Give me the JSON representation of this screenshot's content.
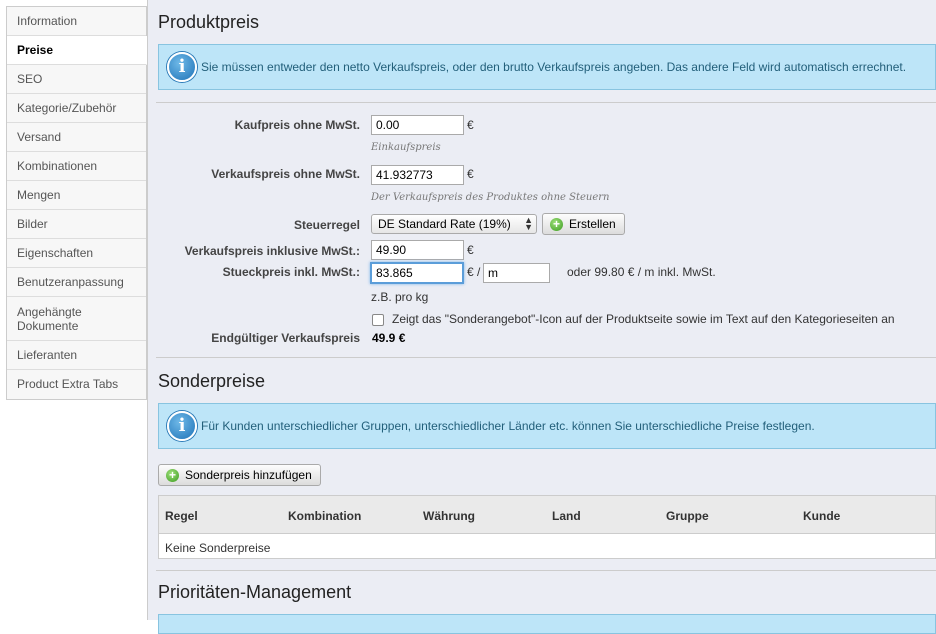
{
  "sidebar": {
    "items": [
      {
        "label": "Information"
      },
      {
        "label": "Preise"
      },
      {
        "label": "SEO"
      },
      {
        "label": "Kategorie/Zubehör"
      },
      {
        "label": "Versand"
      },
      {
        "label": "Kombinationen"
      },
      {
        "label": "Mengen"
      },
      {
        "label": "Bilder"
      },
      {
        "label": "Eigenschaften"
      },
      {
        "label": "Benutzeranpassung"
      },
      {
        "label": "Angehängte Dokumente"
      },
      {
        "label": "Lieferanten"
      },
      {
        "label": "Product Extra Tabs"
      }
    ],
    "active": "Preise"
  },
  "produktpreis": {
    "title": "Produktpreis",
    "info": "Sie müssen entweder den netto Verkaufspreis, oder den brutto Verkaufspreis angeben. Das andere Feld wird automatisch errechnet.",
    "kaufpreis_label": "Kaufpreis ohne MwSt.",
    "kaufpreis_value": "0.00",
    "kaufpreis_hint": "Einkaufspreis",
    "verkaufspreis_label": "Verkaufspreis ohne MwSt.",
    "verkaufspreis_value": "41.932773",
    "verkaufspreis_hint": "Der Verkaufspreis des Produktes ohne Steuern",
    "steuerregel_label": "Steuerregel",
    "steuerregel_value": "DE Standard Rate (19%)",
    "erstellen_label": "Erstellen",
    "inkl_label": "Verkaufspreis inklusive MwSt.:",
    "inkl_value": "49.90",
    "stueck_label": "Stueckpreis inkl. MwSt.:",
    "stueck_value": "83.865",
    "stueck_unit_sep": "€ /",
    "stueck_unit_value": "m",
    "stueck_info": "oder 99.80 € / m inkl. MwSt.",
    "stueck_hint": "z.B. pro kg",
    "currency": "€",
    "sonder_checkbox_label": "Zeigt das \"Sonderangebot\"-Icon auf der Produktseite sowie im Text auf den Kategorieseiten an",
    "final_label": "Endgültiger Verkaufspreis",
    "final_value": "49.9 €"
  },
  "sonderpreise": {
    "title": "Sonderpreise",
    "info": "Für Kunden unterschiedlicher Gruppen, unterschiedlicher Länder etc. können Sie unterschiedliche Preise festlegen.",
    "add_button": "Sonderpreis hinzufügen",
    "columns": [
      "Regel",
      "Kombination",
      "Währung",
      "Land",
      "Gruppe",
      "Kunde"
    ],
    "empty_text": "Keine Sonderpreise"
  },
  "prioritaeten": {
    "title": "Prioritäten-Management"
  }
}
